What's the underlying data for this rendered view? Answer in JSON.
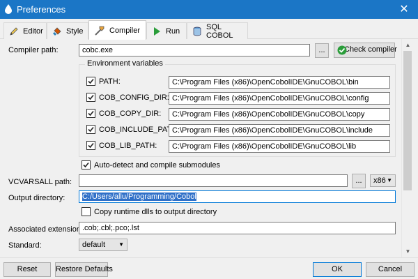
{
  "window": {
    "title": "Preferences",
    "close_glyph": "✕"
  },
  "tabs": [
    {
      "label": "Editor",
      "icon": "pencil-icon"
    },
    {
      "label": "Style",
      "icon": "paint-bucket-icon"
    },
    {
      "label": "Compiler",
      "icon": "compiler-icon",
      "active": true
    },
    {
      "label": "Run",
      "icon": "play-icon"
    },
    {
      "label": "SQL COBOL",
      "icon": "database-icon"
    }
  ],
  "compiler": {
    "path_label": "Compiler path:",
    "path_value": "cobc.exe",
    "browse_label": "...",
    "check_label": "Check compiler"
  },
  "env": {
    "legend": "Environment variables",
    "rows": [
      {
        "name": "PATH:",
        "value": "C:\\Program Files (x86)\\OpenCobolIDE\\GnuCOBOL\\bin",
        "checked": true
      },
      {
        "name": "COB_CONFIG_DIR:",
        "value": "C:\\Program Files (x86)\\OpenCobolIDE\\GnuCOBOL\\config",
        "checked": true
      },
      {
        "name": "COB_COPY_DIR:",
        "value": "C:\\Program Files (x86)\\OpenCobolIDE\\GnuCOBOL\\copy",
        "checked": true
      },
      {
        "name": "COB_INCLUDE_PATH:",
        "value": "C:\\Program Files (x86)\\OpenCobolIDE\\GnuCOBOL\\include",
        "checked": true
      },
      {
        "name": "COB_LIB_PATH:",
        "value": "C:\\Program Files (x86)\\OpenCobolIDE\\GnuCOBOL\\lib",
        "checked": true
      }
    ]
  },
  "auto_detect": {
    "label": "Auto-detect and compile submodules",
    "checked": true
  },
  "vcvarsall": {
    "label": "VCVARSALL path:",
    "value": "",
    "browse_label": "...",
    "arch": "x86"
  },
  "output_dir": {
    "label": "Output directory:",
    "value": "C:/Users/allu/Programming/Cobol"
  },
  "copy_dlls": {
    "label": "Copy runtime dlls to output directory",
    "checked": false
  },
  "extensions": {
    "label": "Associated extensions:",
    "value": ".cob;.cbl;.pco;.lst"
  },
  "standard": {
    "label": "Standard:",
    "value": "default"
  },
  "buttons": {
    "reset": "Reset",
    "restore": "Restore Defaults",
    "ok": "OK",
    "cancel": "Cancel"
  },
  "colors": {
    "titlebar": "#1b76c6",
    "selection": "#3070c8",
    "check_green": "#2a9d3a"
  }
}
